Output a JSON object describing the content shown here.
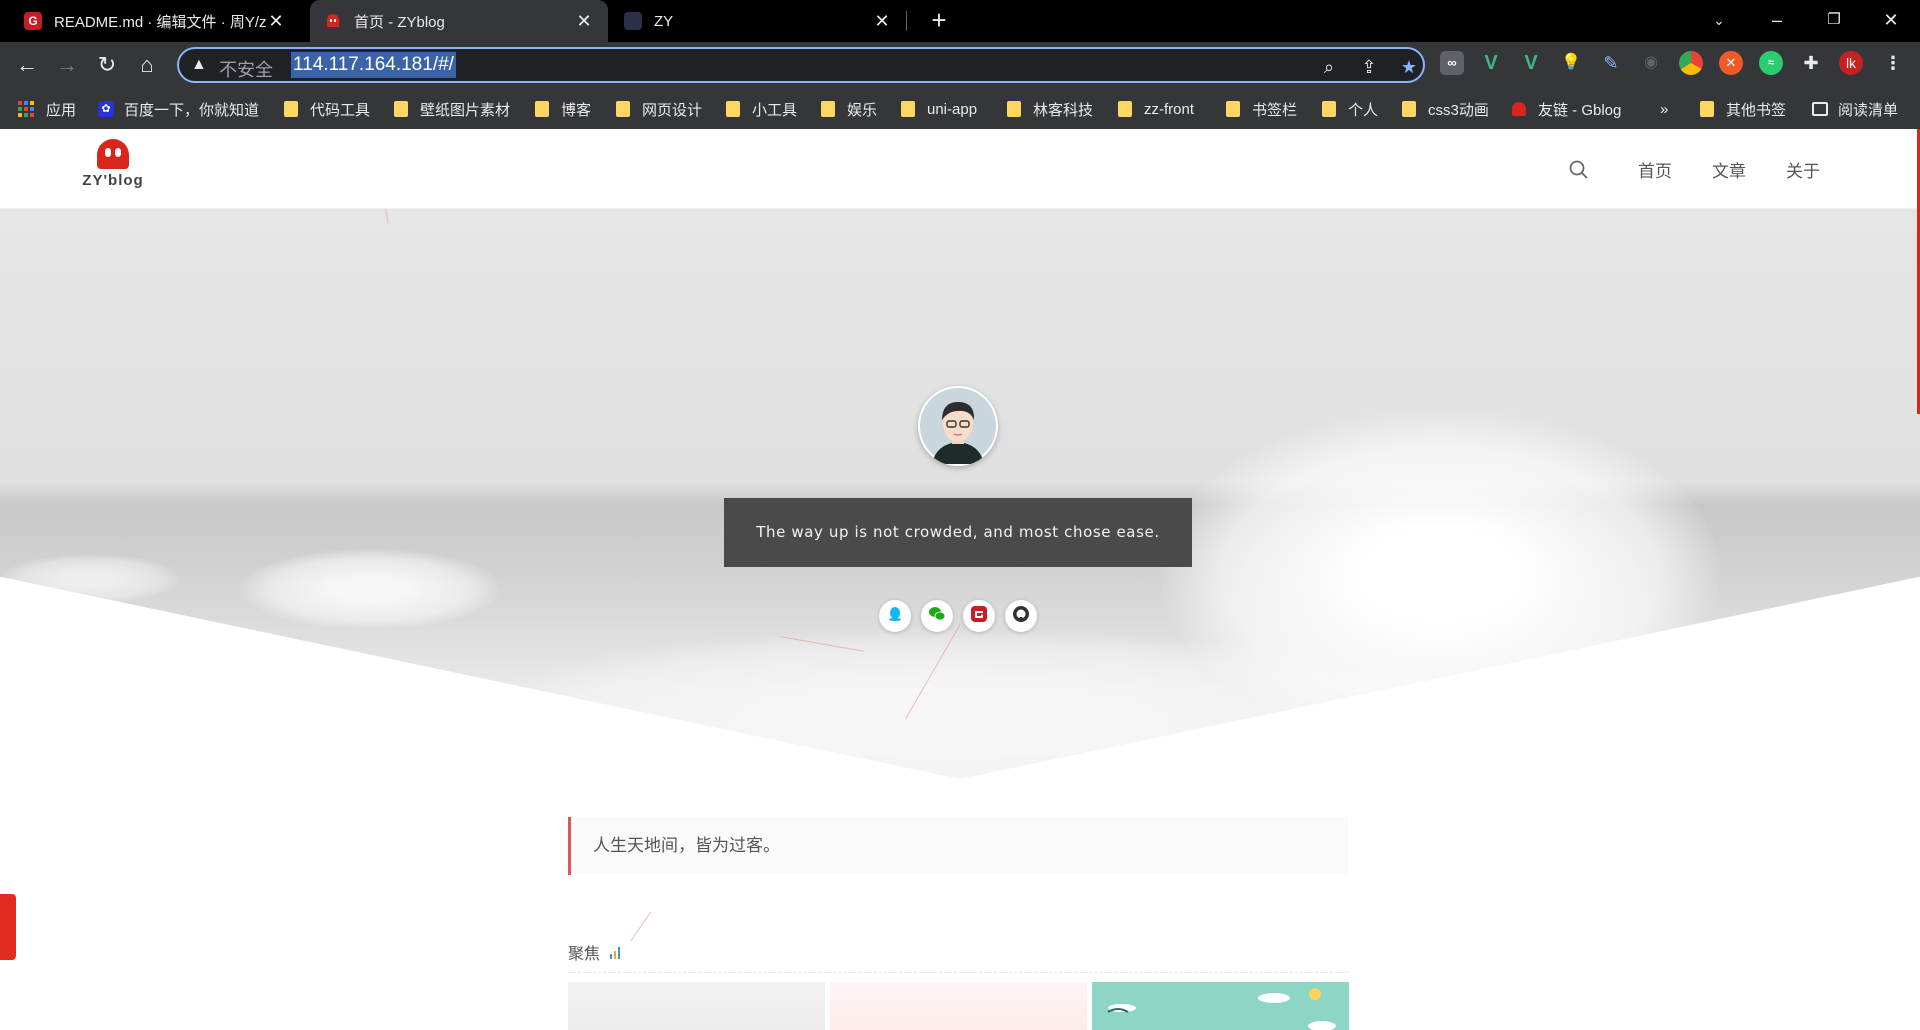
{
  "browser": {
    "tabs": [
      {
        "title": "README.md · 编辑文件 · 周Y/zy",
        "favicon": "G"
      },
      {
        "title": "首页 - ZYblog",
        "favicon": "ghost"
      },
      {
        "title": "ZY",
        "favicon": "zy"
      }
    ],
    "address": {
      "security_label": "不安全",
      "url": "114.117.164.181/#/"
    },
    "profile_initials": "lk",
    "bookmarks": [
      {
        "label": "应用",
        "type": "apps"
      },
      {
        "label": "百度一下，你就知道",
        "type": "baidu"
      },
      {
        "label": "代码工具",
        "type": "folder"
      },
      {
        "label": "壁纸图片素材",
        "type": "folder"
      },
      {
        "label": "博客",
        "type": "folder"
      },
      {
        "label": "网页设计",
        "type": "folder"
      },
      {
        "label": "小工具",
        "type": "folder"
      },
      {
        "label": "娱乐",
        "type": "folder"
      },
      {
        "label": "uni-app",
        "type": "folder"
      },
      {
        "label": "林客科技",
        "type": "folder"
      },
      {
        "label": "zz-front",
        "type": "folder"
      },
      {
        "label": "书签栏",
        "type": "folder"
      },
      {
        "label": "个人",
        "type": "folder"
      },
      {
        "label": "css3动画",
        "type": "folder"
      },
      {
        "label": "友链 - Gblog",
        "type": "site"
      },
      {
        "label": "»",
        "type": "more"
      },
      {
        "label": "其他书签",
        "type": "folder"
      },
      {
        "label": "阅读清单",
        "type": "reading-list"
      }
    ]
  },
  "site": {
    "logo_text": "ZY'blog",
    "nav": [
      "首页",
      "文章",
      "关于"
    ],
    "motto": "The way up is not crowded, and most chose ease.",
    "social": [
      "qq-icon",
      "wechat-icon",
      "gitee-icon",
      "github-icon"
    ],
    "quote": "人生天地间，皆为过客。",
    "focus_title": "聚焦"
  },
  "colors": {
    "accent": "#d8261c",
    "quote_border": "#e0555a",
    "motto_bg": "#4a4a4a",
    "card_teal": "#8dd5c5"
  }
}
